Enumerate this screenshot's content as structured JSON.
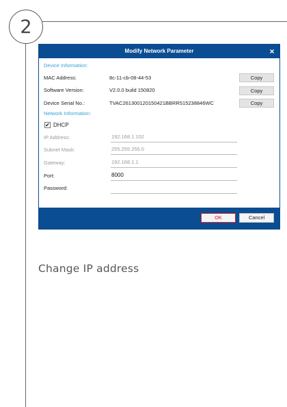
{
  "step": {
    "number": "2"
  },
  "dialog": {
    "title": "Modify Network Parameter",
    "close_icon": "×",
    "device_info": {
      "heading": "Device Information:",
      "mac": {
        "label": "MAC Address:",
        "value": "8c-11-cb-08-44-53",
        "copy_label": "Copy"
      },
      "software": {
        "label": "Software Version:",
        "value": "V2.0.0 build 150820",
        "copy_label": "Copy"
      },
      "serial": {
        "label": "Device Serial No.:",
        "value": "TVAC261300120150421BBRR515238846WC",
        "copy_label": "Copy"
      }
    },
    "network_info": {
      "heading": "Network Information:",
      "dhcp": {
        "label": "DHCP",
        "checked": true,
        "check_glyph": "✔"
      },
      "ip": {
        "label": "IP Address:",
        "value": "192.168.1.102"
      },
      "subnet": {
        "label": "Subnet Mask:",
        "value": "255.255.255.0"
      },
      "gateway": {
        "label": "Gateway:",
        "value": "192.168.1.1"
      },
      "port": {
        "label": "Port:",
        "value": "8000"
      },
      "password": {
        "label": "Password:",
        "value": ""
      }
    },
    "ok_label": "OK",
    "cancel_label": "Cancel"
  },
  "caption": "Change IP address",
  "colors": {
    "titlebar": "#0a4d93",
    "section_heading": "#3aa0d8",
    "ok_border": "#e21d2a"
  }
}
